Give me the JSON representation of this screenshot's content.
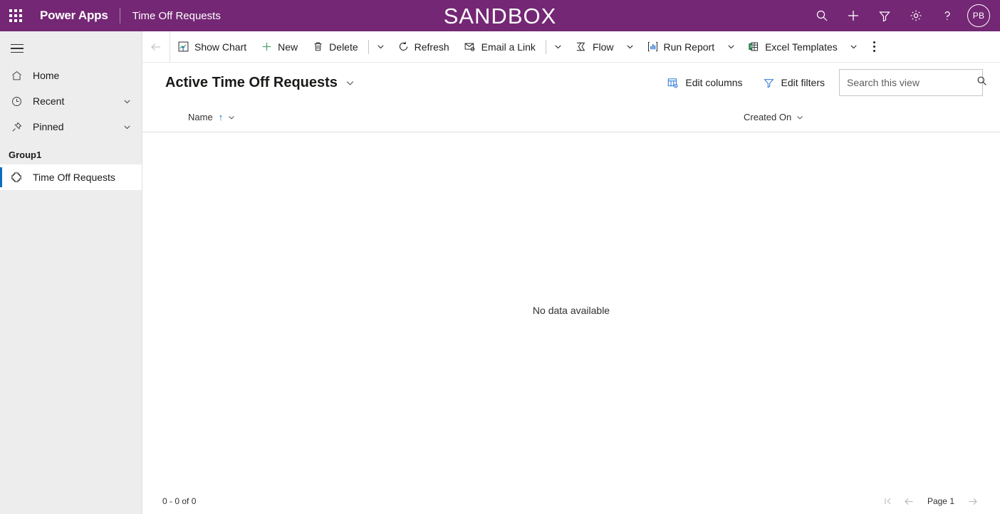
{
  "header": {
    "waffle_icon": "waffle-icon",
    "brand": "Power Apps",
    "app_name": "Time Off Requests",
    "environment_badge": "SANDBOX",
    "accent_color": "#742774",
    "actions": [
      {
        "name": "search-icon",
        "label": "Search"
      },
      {
        "name": "plus-icon",
        "label": "New"
      },
      {
        "name": "filter-icon",
        "label": "Filter"
      },
      {
        "name": "gear-icon",
        "label": "Settings"
      },
      {
        "name": "help-icon",
        "label": "Help"
      }
    ],
    "avatar_initials": "PB"
  },
  "sidebar": {
    "hamburger_label": "Site map",
    "items": [
      {
        "label": "Home",
        "icon": "home-icon",
        "expandable": false
      },
      {
        "label": "Recent",
        "icon": "clock-icon",
        "expandable": true
      },
      {
        "label": "Pinned",
        "icon": "pin-icon",
        "expandable": true
      }
    ],
    "group_title": "Group1",
    "group_items": [
      {
        "label": "Time Off Requests",
        "icon": "entity-icon",
        "selected": true
      }
    ],
    "selected_accent": "#0f6cbd"
  },
  "commandbar": {
    "back_label": "Back",
    "buttons": [
      {
        "label": "Show Chart",
        "icon": "chart-icon",
        "caret": false
      },
      {
        "label": "New",
        "icon": "plus-icon",
        "caret": false
      },
      {
        "label": "Delete",
        "icon": "trash-icon",
        "caret": true
      },
      {
        "label": "Refresh",
        "icon": "refresh-icon",
        "caret": false
      },
      {
        "label": "Email a Link",
        "icon": "email-link-icon",
        "caret": true
      },
      {
        "label": "Flow",
        "icon": "flow-icon",
        "caret": true
      },
      {
        "label": "Run Report",
        "icon": "report-icon",
        "caret": true
      },
      {
        "label": "Excel Templates",
        "icon": "excel-icon",
        "caret": true
      }
    ],
    "overflow_label": "More commands"
  },
  "view": {
    "title": "Active Time Off Requests",
    "edit_columns_label": "Edit columns",
    "edit_filters_label": "Edit filters",
    "search_placeholder": "Search this view",
    "search_value": ""
  },
  "grid": {
    "columns": [
      {
        "label": "Name",
        "sorted": "asc"
      },
      {
        "label": "Created On",
        "sorted": "none"
      }
    ],
    "empty_message": "No data available",
    "rows": []
  },
  "footer": {
    "record_count": "0 - 0 of 0",
    "page_label": "Page 1",
    "first_page_label": "First page",
    "previous_page_label": "Previous page",
    "next_page_label": "Next page"
  }
}
